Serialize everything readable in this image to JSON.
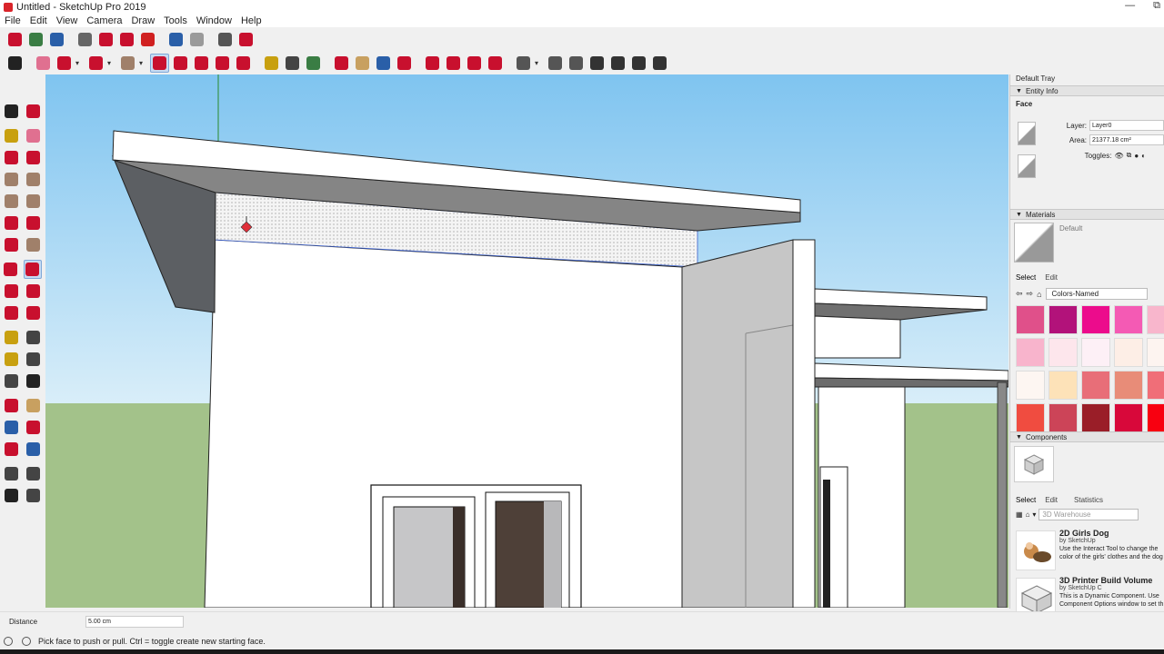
{
  "window": {
    "title": "Untitled - SketchUp Pro 2019",
    "min_glyph": "—",
    "max_glyph": "⧉"
  },
  "menu": [
    "File",
    "Edit",
    "View",
    "Camera",
    "Draw",
    "Tools",
    "Window",
    "Help"
  ],
  "toolbar_top": {
    "icons": [
      {
        "name": "3d-warehouse-icon",
        "color": "#c8102e"
      },
      {
        "name": "open-file-icon",
        "color": "#3a7d44"
      },
      {
        "name": "save-icon",
        "color": "#2a5fa8"
      },
      {
        "name": "cut-icon",
        "color": "#666666"
      },
      {
        "name": "copy-icon",
        "color": "#c8102e"
      },
      {
        "name": "paste-icon",
        "color": "#c8102e"
      },
      {
        "name": "erase-icon",
        "color": "#d02020"
      },
      {
        "name": "undo-icon",
        "color": "#2a5fa8"
      },
      {
        "name": "redo-icon",
        "color": "#9a9a9a"
      },
      {
        "name": "print-icon",
        "color": "#555555"
      },
      {
        "name": "model-info-icon",
        "color": "#c8102e"
      }
    ]
  },
  "toolbar_second": {
    "icons": [
      {
        "name": "select-arrow-icon",
        "color": "#222222"
      },
      {
        "name": "eraser-icon",
        "color": "#e07090"
      },
      {
        "name": "line-pencil-icon",
        "color": "#c8102e"
      },
      {
        "name": "arc-icon",
        "color": "#c8102e"
      },
      {
        "name": "rectangle-icon",
        "color": "#a0806a"
      },
      {
        "name": "push-pull-icon",
        "color": "#c8102e",
        "selected": true
      },
      {
        "name": "follow-me-icon",
        "color": "#c8102e"
      },
      {
        "name": "move-icon",
        "color": "#c8102e"
      },
      {
        "name": "rotate-icon",
        "color": "#c8102e"
      },
      {
        "name": "scale-icon",
        "color": "#c8102e"
      },
      {
        "name": "tape-measure-icon",
        "color": "#c8a010"
      },
      {
        "name": "text-icon",
        "color": "#444444"
      },
      {
        "name": "paint-bucket-icon",
        "color": "#3a7d44"
      },
      {
        "name": "orbit-icon",
        "color": "#c8102e"
      },
      {
        "name": "pan-icon",
        "color": "#c8a060"
      },
      {
        "name": "zoom-icon",
        "color": "#2a5fa8"
      },
      {
        "name": "zoom-extents-icon",
        "color": "#c8102e"
      },
      {
        "name": "component-icon",
        "color": "#c8102e"
      },
      {
        "name": "component-2-icon",
        "color": "#c8102e"
      },
      {
        "name": "dynamic-component-icon",
        "color": "#c8102e"
      },
      {
        "name": "ruby-icon",
        "color": "#c8102e"
      },
      {
        "name": "user-account-icon",
        "color": "#555555"
      },
      {
        "name": "iso-view-icon",
        "color": "#555555"
      },
      {
        "name": "top-view-icon",
        "color": "#555555"
      },
      {
        "name": "front-view-icon",
        "color": "#333333"
      },
      {
        "name": "right-view-icon",
        "color": "#333333"
      },
      {
        "name": "back-view-icon",
        "color": "#333333"
      },
      {
        "name": "left-view-icon",
        "color": "#333333"
      }
    ]
  },
  "left_tools": [
    [
      "select-icon",
      "make-component-icon"
    ],
    [
      "paint-bucket-icon",
      "eraser-icon"
    ],
    [
      "line-icon",
      "freehand-icon"
    ],
    [
      "rectangle-icon",
      "rotated-rectangle-icon"
    ],
    [
      "circle-icon",
      "polygon-icon"
    ],
    [
      "arc-icon",
      "two-point-arc-icon"
    ],
    [
      "three-point-arc-icon",
      "pie-icon"
    ],
    [
      "move-icon",
      "push-pull-icon"
    ],
    [
      "rotate-icon",
      "follow-me-icon"
    ],
    [
      "scale-icon",
      "offset-icon"
    ],
    [
      "tape-measure-icon",
      "dimension-icon"
    ],
    [
      "protractor-icon",
      "text-icon"
    ],
    [
      "axes-icon",
      "3d-text-icon"
    ],
    [
      "orbit-icon",
      "pan-icon"
    ],
    [
      "zoom-icon",
      "zoom-window-icon"
    ],
    [
      "zoom-extents-icon",
      "previous-view-icon"
    ],
    [
      "position-camera-icon",
      "look-around-icon"
    ],
    [
      "walk-icon",
      "section-plane-icon"
    ]
  ],
  "tray": {
    "title": "Default Tray",
    "entity_info": {
      "header": "Entity Info",
      "type": "Face",
      "layer_label": "Layer:",
      "layer_value": "Layer0",
      "area_label": "Area:",
      "area_value": "21377.18 cm²",
      "toggles_label": "Toggles:"
    },
    "materials": {
      "header": "Materials",
      "current": "Default",
      "tab_select": "Select",
      "tab_edit": "Edit",
      "library": "Colors-Named",
      "swatches": [
        "#e0508a",
        "#b2127a",
        "#ec0c8c",
        "#f45ab4",
        "#f8b6cc",
        "#f8b4cc",
        "#fde6ec",
        "#fdf0f6",
        "#fdeee6",
        "#fdf4f0",
        "#fdf6f2",
        "#fde2b8",
        "#e86e78",
        "#e88c78",
        "#f06e78",
        "#f04c40",
        "#cc4458",
        "#9a1e28",
        "#d8083a",
        "#f80010"
      ]
    },
    "components": {
      "header": "Components",
      "tab_select": "Select",
      "tab_edit": "Edit",
      "tab_statistics": "Statistics",
      "search_placeholder": "3D Warehouse",
      "items": [
        {
          "name": "2D Girls Dog",
          "by": "by SketchUp",
          "desc1": "Use the Interact Tool to change the",
          "desc2": "color of the girls' clothes and the dog"
        },
        {
          "name": "3D Printer Build Volume",
          "by": "by SketchUp C",
          "desc1": "This is a Dynamic Component. Use",
          "desc2": "Component Options window to set th"
        }
      ]
    }
  },
  "measurements": {
    "label": "Distance",
    "value": "5.00 cm"
  },
  "status": {
    "message": "Pick face to push or pull.  Ctrl = toggle create new starting face."
  }
}
